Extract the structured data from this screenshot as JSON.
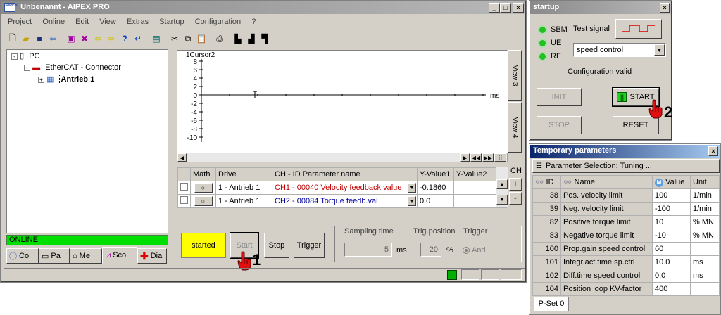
{
  "main_window": {
    "title": "Unbenannt - AIPEX PRO",
    "menu": [
      "Project",
      "Online",
      "Edit",
      "View",
      "Extras",
      "Startup",
      "Configuration",
      "?"
    ]
  },
  "tree": {
    "root": "PC",
    "connector": "EtherCAT - Connector",
    "drive": "Antrieb 1"
  },
  "status": {
    "online": "ONLINE"
  },
  "bottom_tabs": [
    "Co",
    "Pa",
    "Me",
    "Sco",
    "Dia"
  ],
  "scope": {
    "cursor_label": "1Cursor2",
    "y_ticks": [
      "8",
      "6",
      "4",
      "2",
      "0",
      "-2",
      "-4",
      "-6",
      "-8",
      "-10"
    ],
    "x_unit": "ms",
    "view_tabs": [
      "View 3",
      "View 4"
    ]
  },
  "channels": {
    "headers": [
      "Math",
      "Drive",
      "CH - ID Parameter name",
      "Y-Value1",
      "Y-Value2"
    ],
    "side_label": "CH",
    "rows": [
      {
        "drive": "1 - Antrieb 1",
        "param": "CH1 - 00040   Velocity feedback value",
        "y1": "-0.1860",
        "color": "#c00000"
      },
      {
        "drive": "1 - Antrieb 1",
        "param": "CH2 - 00084   Torque feedb.val",
        "y1": "0.0",
        "color": "#0000a0"
      }
    ]
  },
  "control": {
    "state": "started",
    "start": "Start",
    "stop": "Stop",
    "trigger": "Trigger",
    "sampling_label": "Sampling time",
    "sampling_value": "5",
    "sampling_unit": "ms",
    "trig_pos_label": "Trig.position",
    "trig_pos_value": "20",
    "trig_pos_unit": "%",
    "trigger_label": "Trigger",
    "and_label": "And"
  },
  "callouts": {
    "one": "1",
    "two": "2"
  },
  "startup": {
    "title": "startup",
    "leds": [
      "SBM",
      "UE",
      "RF"
    ],
    "test_signal_label": "Test signal :",
    "mode": "speed control",
    "config_status": "Configuration valid",
    "init": "INIT",
    "start": "START",
    "stop": "STOP",
    "reset": "RESET"
  },
  "temp_params": {
    "title": "Temporary parameters",
    "selection": "Parameter Selection: Tuning ...",
    "headers": [
      "ID",
      "Name",
      "Value",
      "Unit"
    ],
    "rows": [
      {
        "id": "38",
        "name": "Pos. velocity limit",
        "value": "100",
        "unit": "1/min"
      },
      {
        "id": "39",
        "name": "Neg. velocity limit",
        "value": "-100",
        "unit": "1/min"
      },
      {
        "id": "82",
        "name": "Positive torque limit",
        "value": "10",
        "unit": "% MN"
      },
      {
        "id": "83",
        "name": "Negative torque limit",
        "value": "-10",
        "unit": "% MN"
      },
      {
        "id": "100",
        "name": "Prop.gain speed control",
        "value": "60",
        "unit": ""
      },
      {
        "id": "101",
        "name": "Integr.act.time sp.ctrl",
        "value": "10.0",
        "unit": "ms"
      },
      {
        "id": "102",
        "name": "Diff.time speed control",
        "value": "0.0",
        "unit": "ms"
      },
      {
        "id": "104",
        "name": "Position loop KV-factor",
        "value": "400",
        "unit": ""
      }
    ],
    "pset_tab": "P-Set 0"
  },
  "colors": {
    "online_green": "#00e000",
    "started_yellow": "#ffff00",
    "active_title": "#0a246a"
  }
}
